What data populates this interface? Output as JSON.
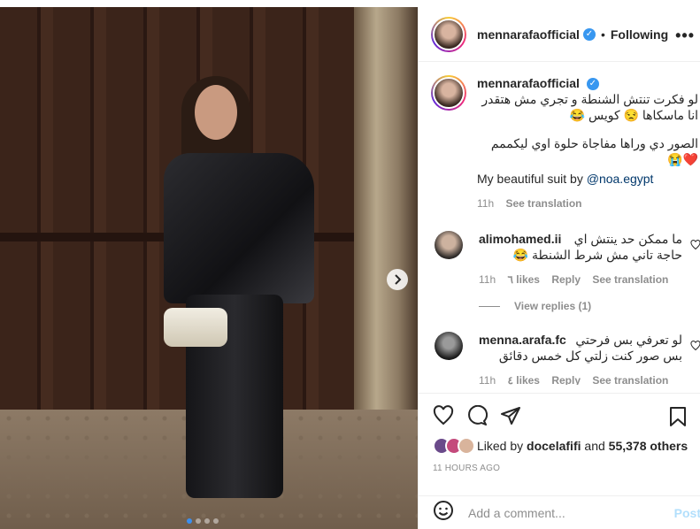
{
  "post": {
    "username": "mennarafaofficial",
    "follow_status": "Following",
    "more_label": "•••",
    "caption": {
      "line1": "لو فكرت تنتش الشنطة و تجري مش هتقدر انا ماسكاها 😒 كويس 😂",
      "line2": "الصور دي وراها مفاجاة حلوة اوي ليكممم ❤️😭",
      "line3_text": "My beautiful suit by",
      "line3_tag": "@noa.egypt",
      "time": "11h",
      "see_translation": "See translation"
    },
    "comments": [
      {
        "username": "alimohamed.ii",
        "text": "ما ممكن حد ينتش اي حاجة تاني مش شرط الشنطة 😂",
        "time": "11h",
        "likes": "٦ likes",
        "reply": "Reply",
        "see_translation": "See translation",
        "view_replies": "View replies (1)"
      },
      {
        "username": "menna.arafa.fc",
        "text": "لو تعرفي بس فرحتي بس صور كنت زلتي كل خمس دقائق",
        "time": "11h",
        "likes": "٤ likes",
        "reply": "Reply",
        "see_translation": "See translation"
      }
    ],
    "liked_by": {
      "prefix": "Liked by",
      "user": "docelafifi",
      "and": "and",
      "others": "55,378 others"
    },
    "timestamp": "11 HOURS AGO",
    "add_comment_placeholder": "Add a comment...",
    "post_label": "Post",
    "carousel": {
      "count": 4,
      "active": 0
    },
    "icons": {
      "like": "heart-icon",
      "comment": "comment-icon",
      "share": "share-icon",
      "save": "bookmark-icon",
      "emoji": "emoji-icon",
      "next": "chevron-right-icon",
      "verified": "verified-badge-icon"
    },
    "colors": {
      "accent": "#3897f0",
      "post_disabled": "#b2dffc",
      "muted": "#8e8e8e"
    }
  }
}
